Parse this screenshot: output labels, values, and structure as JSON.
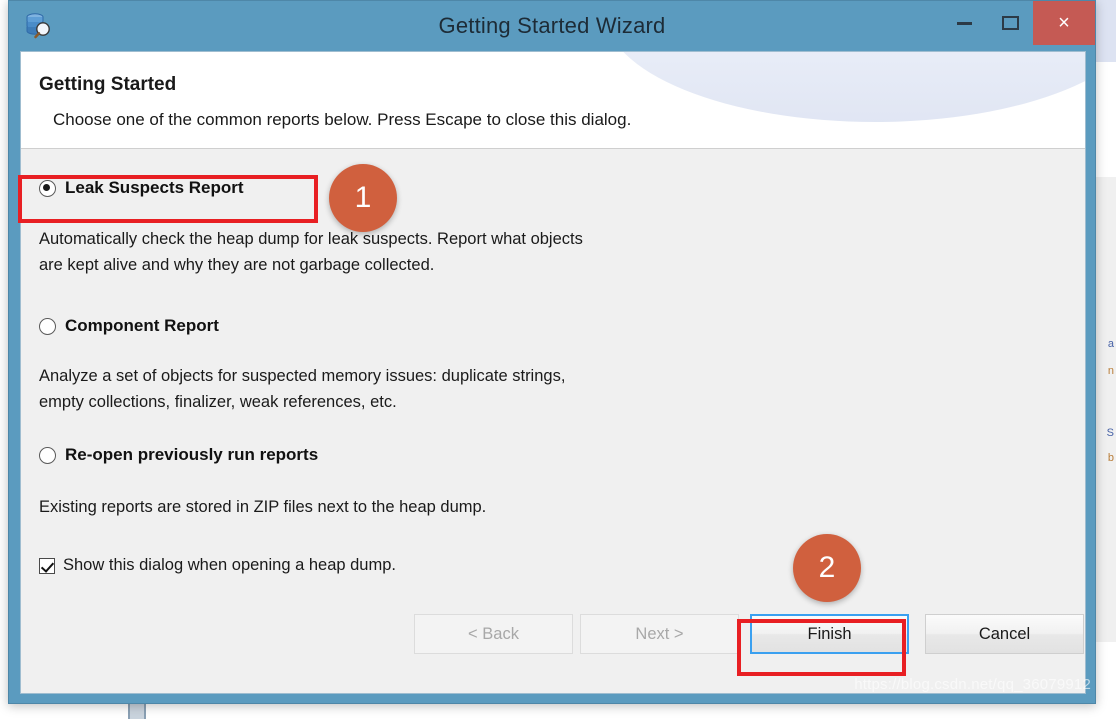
{
  "window": {
    "title": "Getting Started Wizard",
    "icon": "memory-analyzer-icon",
    "controls": {
      "minimize": "minimize-icon",
      "maximize": "maximize-icon",
      "close": "×"
    }
  },
  "banner": {
    "title": "Getting Started",
    "subtitle": "Choose one of the common reports below. Press Escape to close this dialog."
  },
  "options": [
    {
      "label": "Leak Suspects Report",
      "selected": true,
      "description": "Automatically check the heap dump for leak suspects. Report what objects\nare kept alive and why they are not garbage collected."
    },
    {
      "label": "Component Report",
      "selected": false,
      "description": "Analyze a set of objects for suspected memory issues: duplicate strings,\nempty collections, finalizer, weak references, etc."
    },
    {
      "label": "Re-open previously run reports",
      "selected": false,
      "description": "Existing reports are stored in ZIP files next to the heap dump."
    }
  ],
  "checkbox": {
    "label": "Show this dialog when opening a heap dump.",
    "checked": true
  },
  "buttons": {
    "back": "< Back",
    "next": "Next >",
    "finish": "Finish",
    "cancel": "Cancel"
  },
  "annotations": {
    "badge_one": "1",
    "badge_two": "2",
    "highlight_color": "#e81f23",
    "badge_color": "#d0603e"
  },
  "watermark": "https://blog.csdn.net/qq_36079912",
  "background_fragments": [
    "a",
    "n",
    "S",
    "b"
  ],
  "colors": {
    "titlebar": "#5b9bbf",
    "close_button": "#c55a54",
    "dialog_bg": "#f0f0f0",
    "focus_blue": "#3aa0f0"
  }
}
